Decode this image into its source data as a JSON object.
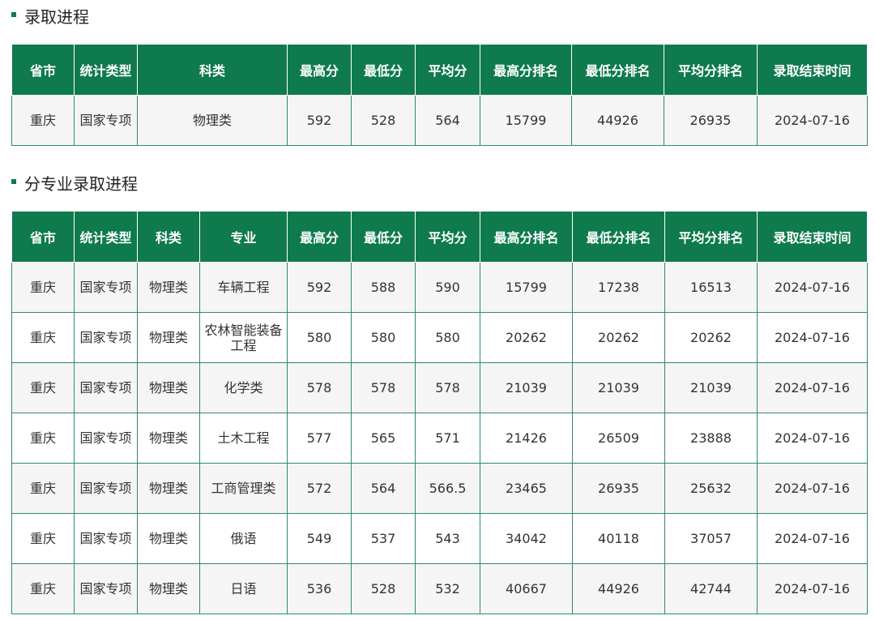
{
  "section1": {
    "title": "录取进程",
    "headers": [
      "省市",
      "统计类型",
      "科类",
      "最高分",
      "最低分",
      "平均分",
      "最高分排名",
      "最低分排名",
      "平均分排名",
      "录取结束时间"
    ],
    "rows": [
      [
        "重庆",
        "国家专项",
        "物理类",
        "592",
        "528",
        "564",
        "15799",
        "44926",
        "26935",
        "2024-07-16"
      ]
    ]
  },
  "section2": {
    "title": "分专业录取进程",
    "headers": [
      "省市",
      "统计类型",
      "科类",
      "专业",
      "最高分",
      "最低分",
      "平均分",
      "最高分排名",
      "最低分排名",
      "平均分排名",
      "录取结束时间"
    ],
    "rows": [
      [
        "重庆",
        "国家专项",
        "物理类",
        "车辆工程",
        "592",
        "588",
        "590",
        "15799",
        "17238",
        "16513",
        "2024-07-16"
      ],
      [
        "重庆",
        "国家专项",
        "物理类",
        "农林智能装备工程",
        "580",
        "580",
        "580",
        "20262",
        "20262",
        "20262",
        "2024-07-16"
      ],
      [
        "重庆",
        "国家专项",
        "物理类",
        "化学类",
        "578",
        "578",
        "578",
        "21039",
        "21039",
        "21039",
        "2024-07-16"
      ],
      [
        "重庆",
        "国家专项",
        "物理类",
        "土木工程",
        "577",
        "565",
        "571",
        "21426",
        "26509",
        "23888",
        "2024-07-16"
      ],
      [
        "重庆",
        "国家专项",
        "物理类",
        "工商管理类",
        "572",
        "564",
        "566.5",
        "23465",
        "26935",
        "25632",
        "2024-07-16"
      ],
      [
        "重庆",
        "国家专项",
        "物理类",
        "俄语",
        "549",
        "537",
        "543",
        "34042",
        "40118",
        "37057",
        "2024-07-16"
      ],
      [
        "重庆",
        "国家专项",
        "物理类",
        "日语",
        "536",
        "528",
        "532",
        "40667",
        "44926",
        "42744",
        "2024-07-16"
      ]
    ]
  }
}
